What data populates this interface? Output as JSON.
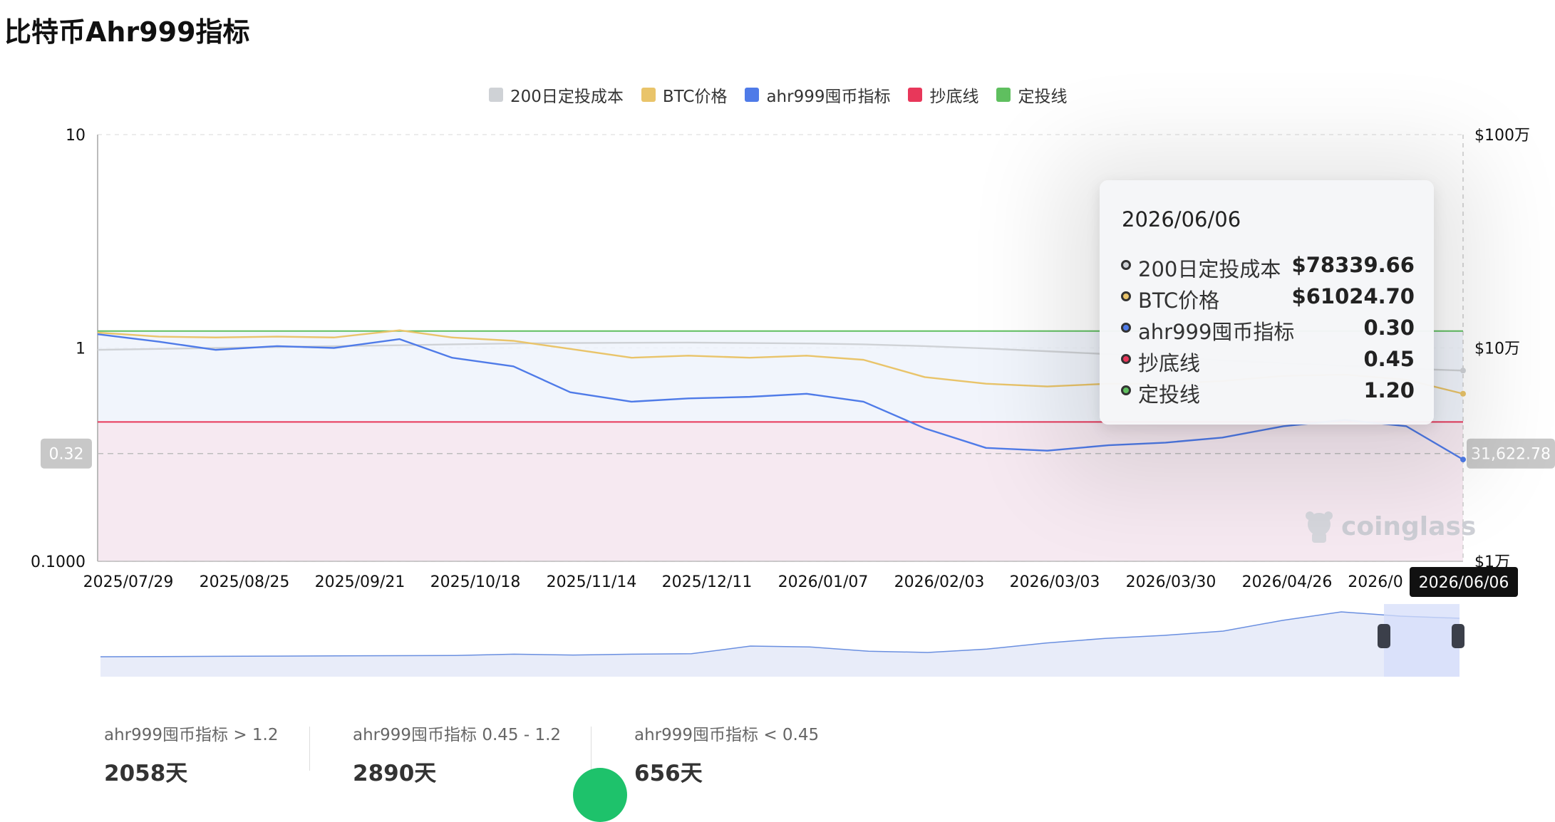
{
  "page": {
    "title": "比特币Ahr999指标"
  },
  "legend": [
    {
      "label": "200日定投成本",
      "color": "#cfd2d6"
    },
    {
      "label": "BTC价格",
      "color": "#e9c46a"
    },
    {
      "label": "ahr999囤币指标",
      "color": "#4f7be8"
    },
    {
      "label": "抄底线",
      "color": "#e8375a"
    },
    {
      "label": "定投线",
      "color": "#5fbf5f"
    }
  ],
  "tooltip": {
    "date": "2026/06/06",
    "rows": [
      {
        "label": "200日定投成本",
        "value": "$78339.66",
        "color": "#cfd2d6"
      },
      {
        "label": "BTC价格",
        "value": "$61024.70",
        "color": "#e9c46a"
      },
      {
        "label": "ahr999囤币指标",
        "value": "0.30",
        "color": "#4f7be8"
      },
      {
        "label": "抄底线",
        "value": "0.45",
        "color": "#e8375a"
      },
      {
        "label": "定投线",
        "value": "1.20",
        "color": "#5fbf5f"
      }
    ]
  },
  "crosshair": {
    "left_label": "0.32",
    "right_label": "31,622.78",
    "x_label": "2026/06/06"
  },
  "watermark": "coinglass",
  "stats": [
    {
      "label": "ahr999囤币指标 > 1.2",
      "value": "2058天"
    },
    {
      "label": "ahr999囤币指标 0.45 - 1.2",
      "value": "2890天"
    },
    {
      "label": "ahr999囤币指标 < 0.45",
      "value": "656天"
    }
  ],
  "chart_data": {
    "type": "line",
    "x_ticks": [
      "2025/07/29",
      "2025/08/25",
      "2025/09/21",
      "2025/10/18",
      "2025/11/14",
      "2025/12/11",
      "2026/01/07",
      "2026/02/03",
      "2026/03/03",
      "2026/03/30",
      "2026/04/26",
      "2026/0",
      "2026/06/06"
    ],
    "y_left": {
      "scale": "log",
      "range": [
        0.1,
        10
      ],
      "tick_labels": [
        "10",
        "1",
        "0.1000"
      ]
    },
    "y_right": {
      "scale": "log",
      "range": [
        10000,
        1000000
      ],
      "tick_labels": [
        "$100万",
        "$10万",
        "$1万"
      ]
    },
    "x": [
      "2025/07/29",
      "2025/08/12",
      "2025/08/25",
      "2025/09/08",
      "2025/09/21",
      "2025/10/06",
      "2025/10/18",
      "2025/11/01",
      "2025/11/14",
      "2025/11/28",
      "2025/12/11",
      "2025/12/25",
      "2026/01/07",
      "2026/01/20",
      "2026/02/03",
      "2026/02/17",
      "2026/03/03",
      "2026/03/17",
      "2026/03/30",
      "2026/04/12",
      "2026/04/26",
      "2026/05/10",
      "2026/05/24",
      "2026/06/06"
    ],
    "series": [
      {
        "name": "200日定投成本",
        "axis": "right",
        "color": "#cfd2d6",
        "values": [
          98000,
          99000,
          100000,
          101000,
          102000,
          103000,
          104000,
          105000,
          105500,
          105800,
          106000,
          105500,
          105000,
          104000,
          102000,
          99500,
          96500,
          93500,
          90500,
          87500,
          85000,
          82500,
          80000,
          78339.66
        ]
      },
      {
        "name": "BTC价格",
        "axis": "right",
        "color": "#e9c46a",
        "values": [
          118000,
          113000,
          112000,
          113000,
          112000,
          121000,
          112000,
          108000,
          99000,
          90000,
          92000,
          90000,
          92000,
          88000,
          73000,
          68000,
          66000,
          68000,
          68000,
          70000,
          74000,
          75000,
          71000,
          61024.7
        ]
      },
      {
        "name": "ahr999囤币指标",
        "axis": "left",
        "color": "#4f7be8",
        "values": [
          1.16,
          1.07,
          0.98,
          1.02,
          1.0,
          1.1,
          0.9,
          0.82,
          0.62,
          0.56,
          0.58,
          0.59,
          0.61,
          0.56,
          0.42,
          0.34,
          0.33,
          0.35,
          0.36,
          0.38,
          0.43,
          0.46,
          0.43,
          0.3
        ]
      },
      {
        "name": "抄底线",
        "axis": "left",
        "color": "#e8375a",
        "values": [
          0.45
        ]
      },
      {
        "name": "定投线",
        "axis": "left",
        "color": "#5fbf5f",
        "values": [
          1.2
        ]
      }
    ],
    "grid": true,
    "legend_position": "top-center"
  }
}
